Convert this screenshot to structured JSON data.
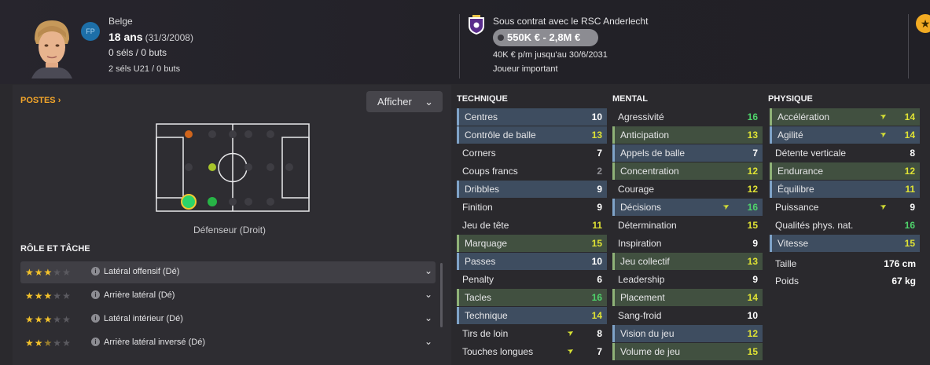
{
  "header": {
    "badge": "FP",
    "nationality": "Belge",
    "age": "18 ans",
    "dob": "(31/3/2008)",
    "caps": "0 séls / 0 buts",
    "u21": "2 séls U21 / 0 buts",
    "contract": "Sous contrat avec le RSC Anderlecht",
    "value": "550K € - 2,8M €",
    "wage": "40K € p/m jusqu'au 30/6/2031",
    "status": "Joueur important"
  },
  "positions": {
    "title": "POSTES",
    "chevron": "›",
    "filter_label": "Afficher",
    "selected_position": "Défenseur (Droit)"
  },
  "roles": {
    "title": "RÔLE ET TÂCHE",
    "items": [
      {
        "label": "Latéral offensif (Dé)",
        "stars": 3
      },
      {
        "label": "Arrière latéral (Dé)",
        "stars": 3
      },
      {
        "label": "Latéral intérieur (Dé)",
        "stars": 3
      },
      {
        "label": "Arrière latéral inversé (Dé)",
        "stars": 2.5
      }
    ]
  },
  "technique": {
    "title": "TECHNIQUE",
    "items": [
      {
        "label": "Centres",
        "value": "10",
        "hl": "blue",
        "tone": "white"
      },
      {
        "label": "Contrôle de balle",
        "value": "13",
        "hl": "blue",
        "tone": "yellow"
      },
      {
        "label": "Corners",
        "value": "7",
        "hl": "",
        "tone": "white"
      },
      {
        "label": "Coups francs",
        "value": "2",
        "hl": "",
        "tone": "grey"
      },
      {
        "label": "Dribbles",
        "value": "9",
        "hl": "blue",
        "tone": "white"
      },
      {
        "label": "Finition",
        "value": "9",
        "hl": "",
        "tone": "white"
      },
      {
        "label": "Jeu de tête",
        "value": "11",
        "hl": "",
        "tone": "yellow"
      },
      {
        "label": "Marquage",
        "value": "15",
        "hl": "green",
        "tone": "yellow"
      },
      {
        "label": "Passes",
        "value": "10",
        "hl": "blue",
        "tone": "white"
      },
      {
        "label": "Penalty",
        "value": "6",
        "hl": "",
        "tone": "white"
      },
      {
        "label": "Tacles",
        "value": "16",
        "hl": "green",
        "tone": "green"
      },
      {
        "label": "Technique",
        "value": "14",
        "hl": "blue",
        "tone": "yellow"
      },
      {
        "label": "Tirs de loin",
        "value": "8",
        "hl": "",
        "tone": "white",
        "arrow": true
      },
      {
        "label": "Touches longues",
        "value": "7",
        "hl": "",
        "tone": "white",
        "arrow": true
      }
    ]
  },
  "mental": {
    "title": "MENTAL",
    "items": [
      {
        "label": "Agressivité",
        "value": "16",
        "hl": "",
        "tone": "green"
      },
      {
        "label": "Anticipation",
        "value": "13",
        "hl": "green",
        "tone": "yellow"
      },
      {
        "label": "Appels de balle",
        "value": "7",
        "hl": "blue",
        "tone": "white"
      },
      {
        "label": "Concentration",
        "value": "12",
        "hl": "green",
        "tone": "yellow"
      },
      {
        "label": "Courage",
        "value": "12",
        "hl": "",
        "tone": "yellow"
      },
      {
        "label": "Décisions",
        "value": "16",
        "hl": "blue",
        "tone": "green",
        "arrow": true
      },
      {
        "label": "Détermination",
        "value": "15",
        "hl": "",
        "tone": "yellow"
      },
      {
        "label": "Inspiration",
        "value": "9",
        "hl": "",
        "tone": "white"
      },
      {
        "label": "Jeu collectif",
        "value": "13",
        "hl": "green",
        "tone": "yellow"
      },
      {
        "label": "Leadership",
        "value": "9",
        "hl": "",
        "tone": "white"
      },
      {
        "label": "Placement",
        "value": "14",
        "hl": "green",
        "tone": "yellow"
      },
      {
        "label": "Sang-froid",
        "value": "10",
        "hl": "",
        "tone": "white"
      },
      {
        "label": "Vision du jeu",
        "value": "12",
        "hl": "blue",
        "tone": "yellow"
      },
      {
        "label": "Volume de jeu",
        "value": "15",
        "hl": "green",
        "tone": "yellow"
      }
    ]
  },
  "physique": {
    "title": "PHYSIQUE",
    "items": [
      {
        "label": "Accélération",
        "value": "14",
        "hl": "green",
        "tone": "yellow",
        "arrow": true
      },
      {
        "label": "Agilité",
        "value": "14",
        "hl": "blue",
        "tone": "yellow",
        "arrow": true
      },
      {
        "label": "Détente verticale",
        "value": "8",
        "hl": "",
        "tone": "white"
      },
      {
        "label": "Endurance",
        "value": "12",
        "hl": "green",
        "tone": "yellow"
      },
      {
        "label": "Équilibre",
        "value": "11",
        "hl": "blue",
        "tone": "yellow"
      },
      {
        "label": "Puissance",
        "value": "9",
        "hl": "",
        "tone": "white",
        "arrow": true
      },
      {
        "label": "Qualités phys. nat.",
        "value": "16",
        "hl": "",
        "tone": "green"
      },
      {
        "label": "Vitesse",
        "value": "15",
        "hl": "blue",
        "tone": "yellow"
      }
    ],
    "height_label": "Taille",
    "height_value": "176 cm",
    "weight_label": "Poids",
    "weight_value": "67 kg"
  },
  "colors": {
    "accent": "#f4a62a",
    "highlight_blue": "#3e4d60",
    "highlight_green": "#415040",
    "value_green": "#4fd36b",
    "value_yellow": "#dfe234"
  }
}
